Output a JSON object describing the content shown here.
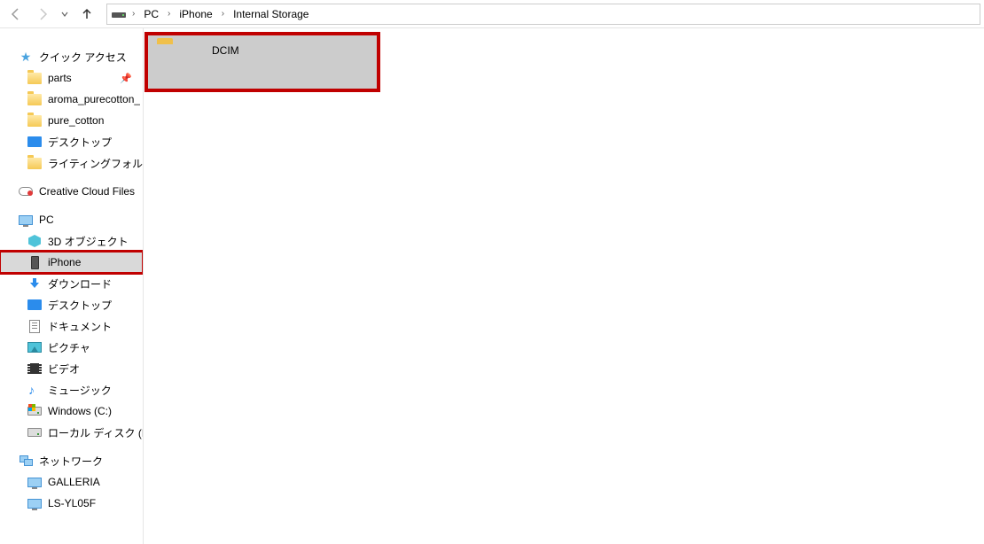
{
  "breadcrumb": {
    "root_icon": "storage-icon",
    "segments": [
      "PC",
      "iPhone",
      "Internal Storage"
    ]
  },
  "sidebar": {
    "quick_access": {
      "label": "クイック アクセス",
      "items": [
        {
          "label": "parts",
          "icon": "folder-icon",
          "pinned": true
        },
        {
          "label": "aroma_purecotton_",
          "icon": "folder-icon"
        },
        {
          "label": "pure_cotton",
          "icon": "folder-icon"
        },
        {
          "label": "デスクトップ",
          "icon": "desktop-icon"
        },
        {
          "label": "ライティングフォルダ",
          "icon": "folder-icon"
        }
      ]
    },
    "creative_cloud": {
      "label": "Creative Cloud Files",
      "icon": "cloud-icon"
    },
    "pc": {
      "label": "PC",
      "items": [
        {
          "label": "3D オブジェクト",
          "icon": "3d-icon"
        },
        {
          "label": "iPhone",
          "icon": "phone-icon",
          "selected": true,
          "highlighted": true
        },
        {
          "label": "ダウンロード",
          "icon": "download-icon"
        },
        {
          "label": "デスクトップ",
          "icon": "desktop-icon"
        },
        {
          "label": "ドキュメント",
          "icon": "document-icon"
        },
        {
          "label": "ピクチャ",
          "icon": "picture-icon"
        },
        {
          "label": "ビデオ",
          "icon": "video-icon"
        },
        {
          "label": "ミュージック",
          "icon": "music-icon"
        },
        {
          "label": "Windows (C:)",
          "icon": "drive-win-icon"
        },
        {
          "label": "ローカル ディスク (D:)",
          "icon": "drive-icon"
        }
      ]
    },
    "network": {
      "label": "ネットワーク",
      "items": [
        {
          "label": "GALLERIA",
          "icon": "monitor-icon"
        },
        {
          "label": "LS-YL05F",
          "icon": "monitor-icon"
        }
      ]
    }
  },
  "content": {
    "folders": [
      {
        "name": "DCIM",
        "icon": "folder-icon",
        "highlighted": true
      }
    ]
  }
}
